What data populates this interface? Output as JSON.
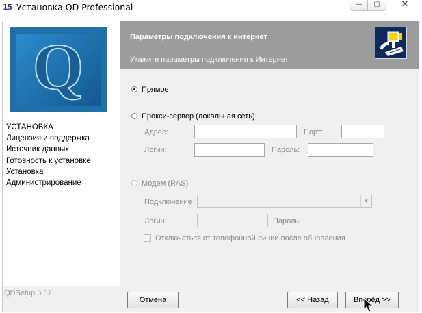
{
  "window": {
    "title": "Установка QD Professional",
    "app_icon_text": "15",
    "minimize_icon": "minimize-icon",
    "maximize_icon": "maximize-icon",
    "close_icon": "close-icon",
    "minimize_glyph": "—",
    "maximize_glyph": "▢",
    "close_glyph": "✕"
  },
  "sidebar": {
    "logo_letter": "Q",
    "steps": [
      {
        "label": "УСТАНОВКА"
      },
      {
        "label": "Лицензия и поддержка"
      },
      {
        "label": "Источник данных"
      },
      {
        "label": "Готовность к установке"
      },
      {
        "label": "Установка"
      },
      {
        "label": "Администрирование"
      }
    ]
  },
  "header": {
    "title": "Параметры подключения к интернет",
    "subtitle": "Укажите параметры подключения к Интернет",
    "icon": "computer-network-icon"
  },
  "connection": {
    "direct": {
      "label": "Прямое",
      "checked": true
    },
    "proxy": {
      "label": "Прокси-сервер (локальная сеть)",
      "checked": false,
      "address_label": "Адрес:",
      "address_value": "",
      "port_label": "Порт:",
      "port_value": "",
      "login_label": "Логин:",
      "login_value": "",
      "password_label": "Пароль:",
      "password_value": ""
    },
    "modem": {
      "label": "Модем (RAS)",
      "checked": false,
      "enabled": false,
      "connection_label": "Подключение",
      "connection_value": "",
      "login_label": "Логин:",
      "login_value": "",
      "password_label": "Пароль:",
      "password_value": "",
      "disconnect_label": "Отключаться от телефонной линии после обновления",
      "disconnect_checked": false
    }
  },
  "footer": {
    "version": "QDSetup 5.57",
    "cancel_label": "Отмена",
    "back_label": "<< Назад",
    "next_label": "Вперёд >>"
  },
  "colors": {
    "header_bg": "#9c9c9c",
    "panel_bg": "#f0f0f0",
    "logo_blue": "#1f6fa8"
  }
}
